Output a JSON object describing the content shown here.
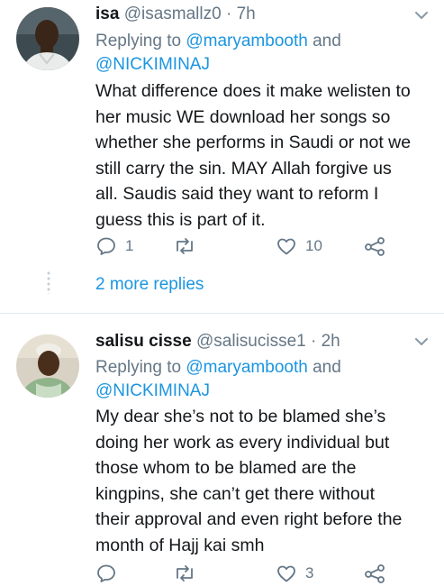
{
  "tweets": [
    {
      "display_name": "isa",
      "handle": "@isasmallz0",
      "time": "· 7h",
      "replying_prefix": "Replying to",
      "replying_mention1": "@maryambooth",
      "replying_and": "and",
      "replying_mention2": "@NICKIMINAJ",
      "text": "What difference does it make welisten to\nher music WE  download her songs so\nwhether she performs in Saudi or not we\nstill carry the sin. MAY Allah forgive us\nall. Saudis said they want to reform I\nguess this is part of it.",
      "reply_count": "1",
      "retweet_count": "",
      "like_count": "10",
      "more_replies": "2 more replies"
    },
    {
      "display_name": "salisu cisse",
      "handle": "@salisucisse1",
      "time": "· 2h",
      "replying_prefix": "Replying to",
      "replying_mention1": "@maryambooth",
      "replying_and": "and",
      "replying_mention2": "@NICKIMINAJ",
      "text": "My dear she’s not to be blamed she’s\ndoing her work as every individual but\nthose whom to be blamed are the\nkingpins, she can’t get there without\ntheir approval and even right before the\nmonth of Hajj kai smh",
      "reply_count": "",
      "retweet_count": "",
      "like_count": "3"
    }
  ],
  "icons": {
    "reply": "reply-icon",
    "retweet": "retweet-icon",
    "like": "heart-icon",
    "share": "share-icon",
    "menu": "chevron-down-icon"
  },
  "colors": {
    "link": "#1b95e0",
    "secondary": "#657786",
    "text": "#14171a",
    "divider": "#e1e8ed"
  }
}
